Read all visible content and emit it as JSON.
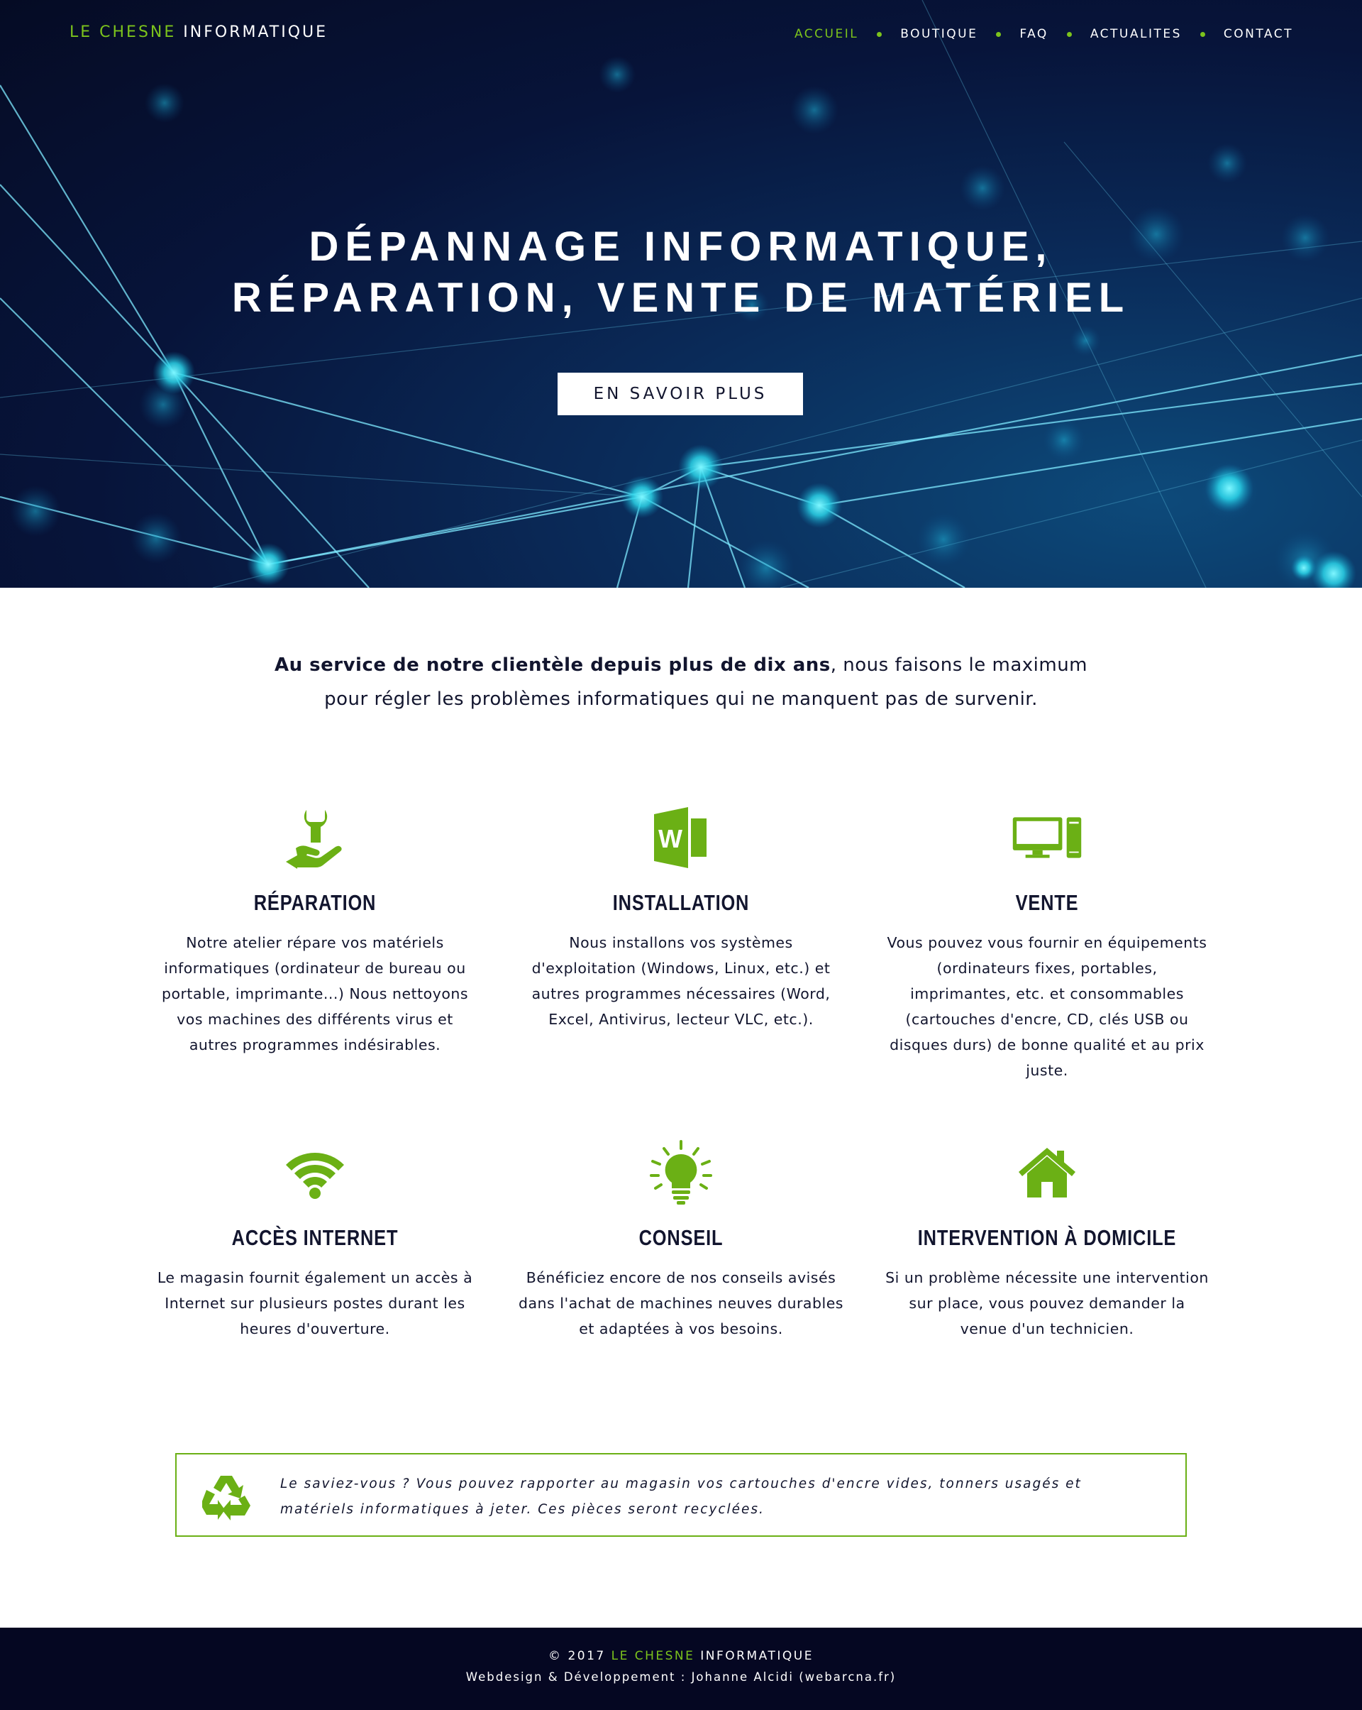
{
  "brand": {
    "part1": "LE CHESNE",
    "part2": "INFORMATIQUE"
  },
  "nav": {
    "items": [
      {
        "label": "ACCUEIL",
        "active": true
      },
      {
        "label": "BOUTIQUE",
        "active": false
      },
      {
        "label": "FAQ",
        "active": false
      },
      {
        "label": "ACTUALITES",
        "active": false
      },
      {
        "label": "CONTACT",
        "active": false
      }
    ]
  },
  "hero": {
    "title_line1": "DÉPANNAGE INFORMATIQUE,",
    "title_line2": "RÉPARATION, VENTE DE MATÉRIEL",
    "button_label": "EN SAVOIR PLUS"
  },
  "intro": {
    "bold": "Au service de notre clientèle depuis plus de dix ans",
    "rest": ", nous faisons le maximum pour régler les problèmes informatiques qui ne manquent pas de survenir."
  },
  "services": [
    {
      "icon": "repair-hand-wrench-icon",
      "title": "RÉPARATION",
      "text": "Notre atelier répare vos matériels informatiques (ordinateur de bureau ou portable, imprimante...) Nous nettoyons vos machines des différents virus et autres programmes indésirables."
    },
    {
      "icon": "word-document-icon",
      "title": "INSTALLATION",
      "text": "Nous installons vos systèmes d'exploitation (Windows, Linux, etc.) et autres programmes nécessaires (Word, Excel, Antivirus, lecteur VLC, etc.)."
    },
    {
      "icon": "desktop-computer-icon",
      "title": "VENTE",
      "text": "Vous pouvez vous fournir en équipements (ordinateurs fixes, portables, imprimantes, etc. et consommables (cartouches d'encre, CD, clés USB ou disques durs) de bonne qualité et au prix juste."
    },
    {
      "icon": "wifi-icon",
      "title": "ACCÈS INTERNET",
      "text": "Le magasin fournit également un accès à Internet sur plusieurs postes durant les heures d'ouverture."
    },
    {
      "icon": "lightbulb-icon",
      "title": "CONSEIL",
      "text": "Bénéficiez encore de nos conseils avisés dans l'achat de machines neuves durables et adaptées à vos besoins."
    },
    {
      "icon": "house-icon",
      "title": "INTERVENTION À DOMICILE",
      "text": "Si un problème nécessite une intervention sur place, vous pouvez demander la venue d'un technicien."
    }
  ],
  "info_box": {
    "icon": "recycle-icon",
    "text": "Le saviez-vous ? Vous pouvez rapporter au magasin vos cartouches d'encre vides, tonners usagés et matériels informatiques à jeter. Ces pièces seront recyclées."
  },
  "footer": {
    "copyright": "© 2017",
    "brand_part1": "LE CHESNE",
    "brand_part2": "INFORMATIQUE",
    "credits": "Webdesign & Développement : Johanne Alcidi (webarcna.fr)"
  },
  "colors": {
    "accent": "#7cc31c",
    "dark": "#12152e",
    "hero_bg": "#07143a",
    "footer_bg": "#050722"
  }
}
